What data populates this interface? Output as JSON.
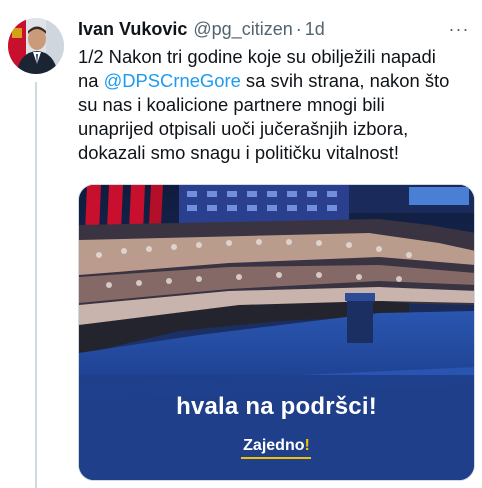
{
  "tweet": {
    "author_name": "Ivan Vukovic",
    "handle": "@pg_citizen",
    "separator": "·",
    "time": "1d",
    "more_label": "···",
    "text_line1": "1/2 Nakon tri godine koje su obilježili napadi",
    "text_line2_before": "na ",
    "mention": "@DPSCrneGore",
    "text_line2_after": " sa svih strana, nakon što",
    "text_line3": "su nas i koalicione partnere mnogi bili",
    "text_line4": "unaprijed otpisali uoči jučerašnjih izbora,",
    "text_line5": "dokazali smo snagu i političku vitalnost!"
  },
  "media": {
    "caption": "hvala na podršci!",
    "brand_word": "Zajedno",
    "brand_mark": "!"
  },
  "colors": {
    "accent": "#1d9bf0",
    "brand_yellow": "#f2c200",
    "banner_blue": "#1f3f8a"
  }
}
